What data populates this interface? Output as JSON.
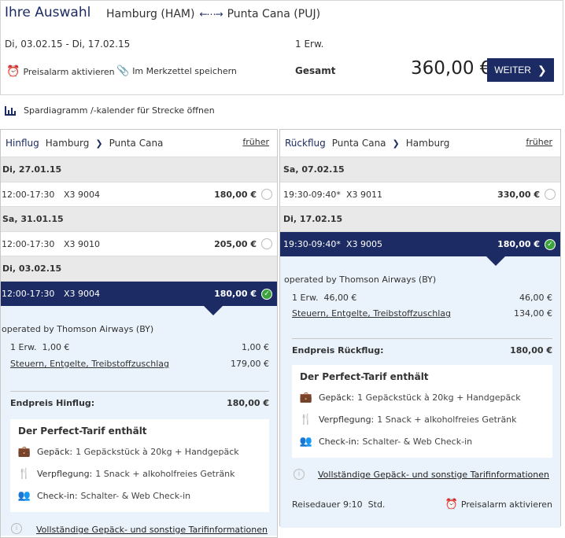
{
  "summary": {
    "title": "Ihre Auswahl",
    "from": "Hamburg (HAM)",
    "to": "Punta Cana (PUJ)",
    "dates": "Di, 03.02.15 - Di, 17.02.15",
    "pax": "1 Erw.",
    "alarm": "Preisalarm aktivieren",
    "merkzettel": "Im Merkzettel speichern",
    "gesamt_label": "Gesamt",
    "total": "360,00 €",
    "weiter": "WEITER"
  },
  "spardiagramm": "Spardiagramm /-kalender für Strecke öffnen",
  "outbound": {
    "label": "Hinflug",
    "from": "Hamburg",
    "to": "Punta Cana",
    "frueher": "früher",
    "days": [
      {
        "date": "Di, 27.01.15",
        "time": "12:00-17:30",
        "flight": "X3 9004",
        "price": "180,00 €"
      },
      {
        "date": "Sa, 31.01.15",
        "time": "12:00-17:30",
        "flight": "X3 9010",
        "price": "205,00 €"
      },
      {
        "date": "Di, 03.02.15",
        "time": "12:00-17:30",
        "flight": "X3 9004",
        "price": "180,00 €"
      }
    ],
    "operated": "operated by Thomson Airways (BY)",
    "fare_label": "1 Erw.  1,00 €",
    "fare_value": "1,00 €",
    "tax_label": "Steuern, Entgelte, Treibstoffzuschlag",
    "tax_value": "179,00 €",
    "end_label": "Endpreis Hinflug:",
    "end_value": "180,00 €"
  },
  "inbound": {
    "label": "Rückflug",
    "from": "Punta Cana",
    "to": "Hamburg",
    "frueher": "früher",
    "days": [
      {
        "date": "Sa, 07.02.15",
        "time": "19:30-09:40*",
        "flight": "X3 9011",
        "price": "330,00 €"
      },
      {
        "date": "Di, 17.02.15",
        "time": "19:30-09:40*",
        "flight": "X3 9005",
        "price": "180,00 €"
      }
    ],
    "operated": "operated by Thomson Airways (BY)",
    "fare_label": "1 Erw.  46,00 €",
    "fare_value": "46,00 €",
    "tax_label": "Steuern, Entgelte, Treibstoffzuschlag",
    "tax_value": "134,00 €",
    "end_label": "Endpreis Rückflug:",
    "end_value": "180,00 €",
    "reisedauer": "Reisedauer 9:10  Std.",
    "alarm": "Preisalarm aktivieren"
  },
  "tarif": {
    "title": "Der Perfect-Tarif enthält",
    "gepaeck_label": "Gepäck:",
    "gepaeck_value": "1 Gepäckstück à 20kg + Handgepäck",
    "verpflegung_label": "Verpflegung:",
    "verpflegung_value": "1 Snack + alkoholfreies Getränk",
    "checkin_label": "Check-in:",
    "checkin_value": "Schalter- & Web Check-in",
    "info_link": "Vollständige Gepäck- und sonstige Tarifinformationen"
  },
  "colors": {
    "navy": "#1c2b63",
    "green": "#3da33d",
    "detail_bg": "#eaf3fb"
  }
}
